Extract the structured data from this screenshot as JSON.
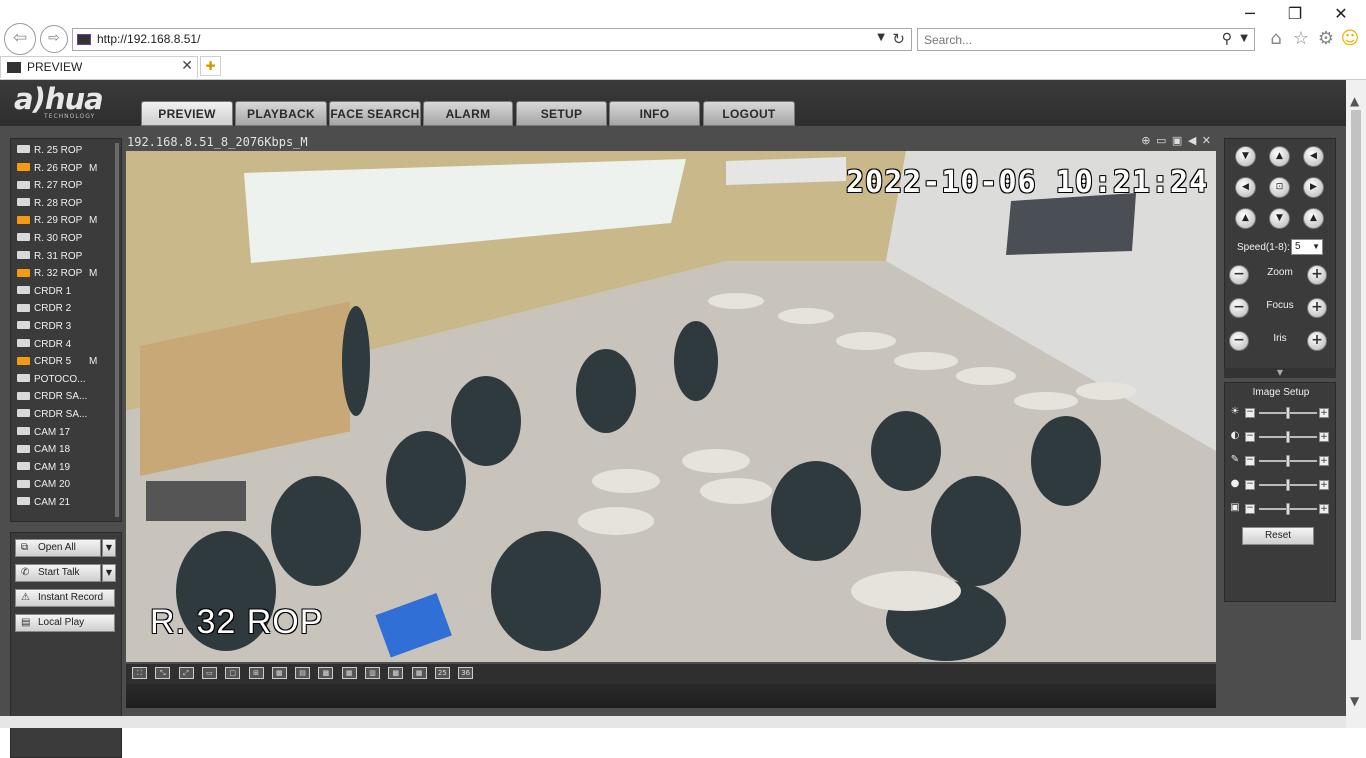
{
  "browser": {
    "window_controls": {
      "minimize": "─",
      "restore": "❐",
      "close": "✕"
    },
    "address_url": "http://192.168.8.51/",
    "search_placeholder": "Search...",
    "tab_title": "PREVIEW",
    "toolbar_icons": [
      "home-icon",
      "star-icon",
      "gear-icon",
      "smiley-icon"
    ]
  },
  "app": {
    "logo": "a)hua",
    "logo_sub": "TECHNOLOGY",
    "menu": [
      {
        "label": "PREVIEW",
        "active": true
      },
      {
        "label": "PLAYBACK",
        "active": false
      },
      {
        "label": "FACE SEARCH",
        "active": false
      },
      {
        "label": "ALARM",
        "active": false
      },
      {
        "label": "SETUP",
        "active": false
      },
      {
        "label": "INFO",
        "active": false
      },
      {
        "label": "LOGOUT",
        "active": false
      }
    ]
  },
  "channels": [
    {
      "name": "R. 25 ROP",
      "recording": false,
      "mark": ""
    },
    {
      "name": "R. 26 ROP",
      "recording": true,
      "mark": "M"
    },
    {
      "name": "R. 27 ROP",
      "recording": false,
      "mark": ""
    },
    {
      "name": "R. 28 ROP",
      "recording": false,
      "mark": ""
    },
    {
      "name": "R. 29 ROP",
      "recording": true,
      "mark": "M"
    },
    {
      "name": "R. 30 ROP",
      "recording": false,
      "mark": ""
    },
    {
      "name": "R. 31 ROP",
      "recording": false,
      "mark": ""
    },
    {
      "name": "R. 32 ROP",
      "recording": true,
      "mark": "M"
    },
    {
      "name": "CRDR 1",
      "recording": false,
      "mark": ""
    },
    {
      "name": "CRDR 2",
      "recording": false,
      "mark": ""
    },
    {
      "name": "CRDR 3",
      "recording": false,
      "mark": ""
    },
    {
      "name": "CRDR 4",
      "recording": false,
      "mark": ""
    },
    {
      "name": "CRDR 5",
      "recording": true,
      "mark": "M"
    },
    {
      "name": "POTOCO...",
      "recording": false,
      "mark": ""
    },
    {
      "name": "CRDR SA...",
      "recording": false,
      "mark": ""
    },
    {
      "name": "CRDR SA...",
      "recording": false,
      "mark": ""
    },
    {
      "name": "CAM 17",
      "recording": false,
      "mark": ""
    },
    {
      "name": "CAM 18",
      "recording": false,
      "mark": ""
    },
    {
      "name": "CAM 19",
      "recording": false,
      "mark": ""
    },
    {
      "name": "CAM 20",
      "recording": false,
      "mark": ""
    },
    {
      "name": "CAM 21",
      "recording": false,
      "mark": ""
    }
  ],
  "controls": {
    "open_all": "Open All",
    "start_talk": "Start Talk",
    "instant_record": "Instant Record",
    "local_play": "Local Play"
  },
  "video": {
    "title": "192.168.8.51_8_2076Kbps_M",
    "osd_time": "2022-10-06 10:21:24",
    "osd_name": "R. 32 ROP"
  },
  "split_layouts": [
    "fullscreen",
    "ratio",
    "fit",
    "wide",
    "1",
    "4",
    "6",
    "8",
    "9",
    "9b",
    "13",
    "16",
    "20",
    "25",
    "36"
  ],
  "ptz": {
    "speed_label": "Speed(1-8):",
    "speed_value": "5",
    "zoom_label": "Zoom",
    "focus_label": "Focus",
    "iris_label": "Iris"
  },
  "image_setup": {
    "title": "Image Setup",
    "sliders": [
      {
        "name": "brightness",
        "icon": "☀",
        "level": 0.5
      },
      {
        "name": "contrast",
        "icon": "◐",
        "level": 0.5
      },
      {
        "name": "saturation",
        "icon": "✎",
        "level": 0.5
      },
      {
        "name": "hue",
        "icon": "●",
        "level": 0.5
      },
      {
        "name": "gain",
        "icon": "▣",
        "level": 0.5
      }
    ],
    "reset_label": "Reset"
  }
}
